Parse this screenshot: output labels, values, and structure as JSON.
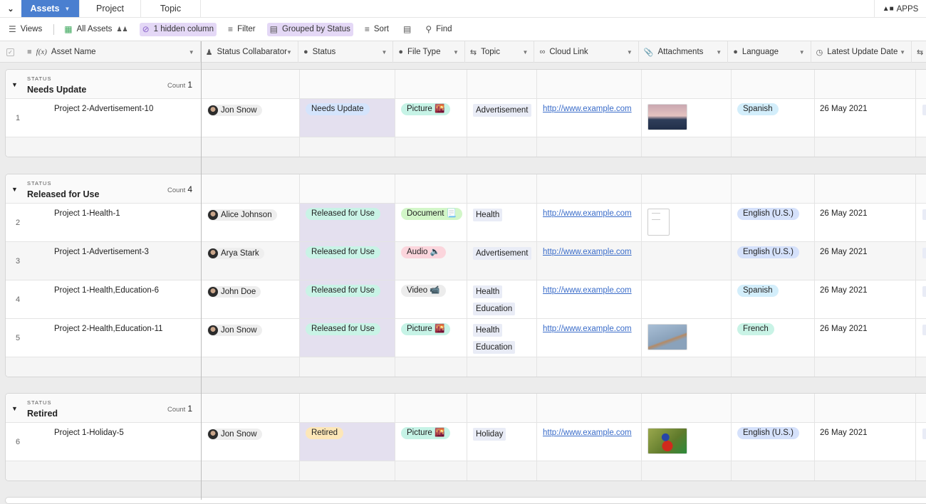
{
  "topbar": {
    "collapse_icon": "chevron-down-icon",
    "tabs": [
      {
        "label": "Assets",
        "active": true
      },
      {
        "label": "Project",
        "active": false
      },
      {
        "label": "Topic",
        "active": false
      }
    ],
    "apps_label": "APPS"
  },
  "toolbar": {
    "views": "Views",
    "view_name": "All Assets",
    "hidden": "1 hidden column",
    "filter": "Filter",
    "grouped": "Grouped by Status",
    "sort": "Sort",
    "find": "Find"
  },
  "columns": [
    {
      "label": "Asset Name",
      "icon": "formula-icon"
    },
    {
      "label": "Status Collabarator",
      "icon": "user-icon"
    },
    {
      "label": "Status",
      "icon": "single-select-icon"
    },
    {
      "label": "File Type",
      "icon": "single-select-icon"
    },
    {
      "label": "Topic",
      "icon": "link-record-icon"
    },
    {
      "label": "Cloud Link",
      "icon": "url-icon"
    },
    {
      "label": "Attachments",
      "icon": "paperclip-icon"
    },
    {
      "label": "Language",
      "icon": "single-select-icon"
    },
    {
      "label": "Latest Update Date",
      "icon": "clock-icon"
    }
  ],
  "group_label": "STATUS",
  "count_label": "Count",
  "colors": {
    "status_needs_update": "#d4e4fc",
    "status_released": "#c9f3e6",
    "status_retired": "#fde7b8",
    "filetype_picture": "#c6f3e6",
    "filetype_document": "#d2f6c8",
    "filetype_audio": "#fbd5dc",
    "filetype_video": "#ececec",
    "lang_spanish": "#d3eefb",
    "lang_english": "#d5e1fb",
    "lang_french": "#c9f3e6",
    "status_column_bg": "#e4e0ef",
    "link": "#3a6cc9",
    "active_tab": "#4a7fd0"
  },
  "groups": [
    {
      "name": "Needs Update",
      "count": "1",
      "rows": [
        {
          "num": "1",
          "name": "Project 2-Advertisement-10",
          "collab": "Jon Snow",
          "status": "Needs Update",
          "filetype": "Picture 🌇",
          "topics": [
            "Advertisement"
          ],
          "link": "http://www.example.com",
          "attachment": "mountain",
          "language": "Spanish",
          "date": "26 May 2021"
        }
      ]
    },
    {
      "name": "Released for Use",
      "count": "4",
      "rows": [
        {
          "num": "2",
          "name": "Project 1-Health-1",
          "collab": "Alice Johnson",
          "status": "Released for Use",
          "filetype": "Document 📃",
          "topics": [
            "Health"
          ],
          "link": "http://www.example.com",
          "attachment": "document",
          "language": "English (U.S.)",
          "date": "26 May 2021"
        },
        {
          "num": "3",
          "name": "Project 1-Advertisement-3",
          "collab": "Arya Stark",
          "status": "Released for Use",
          "filetype": "Audio 🔈",
          "topics": [
            "Advertisement"
          ],
          "link": "http://www.example.com",
          "attachment": "",
          "language": "English (U.S.)",
          "date": "26 May 2021"
        },
        {
          "num": "4",
          "name": "Project 1-Health,Education-6",
          "collab": "John Doe",
          "status": "Released for Use",
          "filetype": "Video 📹",
          "topics": [
            "Health",
            "Education"
          ],
          "link": "http://www.example.com",
          "attachment": "",
          "language": "Spanish",
          "date": "26 May 2021"
        },
        {
          "num": "5",
          "name": "Project 2-Health,Education-11",
          "collab": "Jon Snow",
          "status": "Released for Use",
          "filetype": "Picture 🌇",
          "topics": [
            "Health",
            "Education"
          ],
          "link": "http://www.example.com",
          "attachment": "sign",
          "language": "French",
          "date": "26 May 2021"
        }
      ]
    },
    {
      "name": "Retired",
      "count": "1",
      "rows": [
        {
          "num": "6",
          "name": "Project 1-Holiday-5",
          "collab": "Jon Snow",
          "status": "Retired",
          "filetype": "Picture 🌇",
          "topics": [
            "Holiday"
          ],
          "link": "http://www.example.com",
          "attachment": "parrot",
          "language": "English (U.S.)",
          "date": "26 May 2021"
        }
      ]
    }
  ]
}
